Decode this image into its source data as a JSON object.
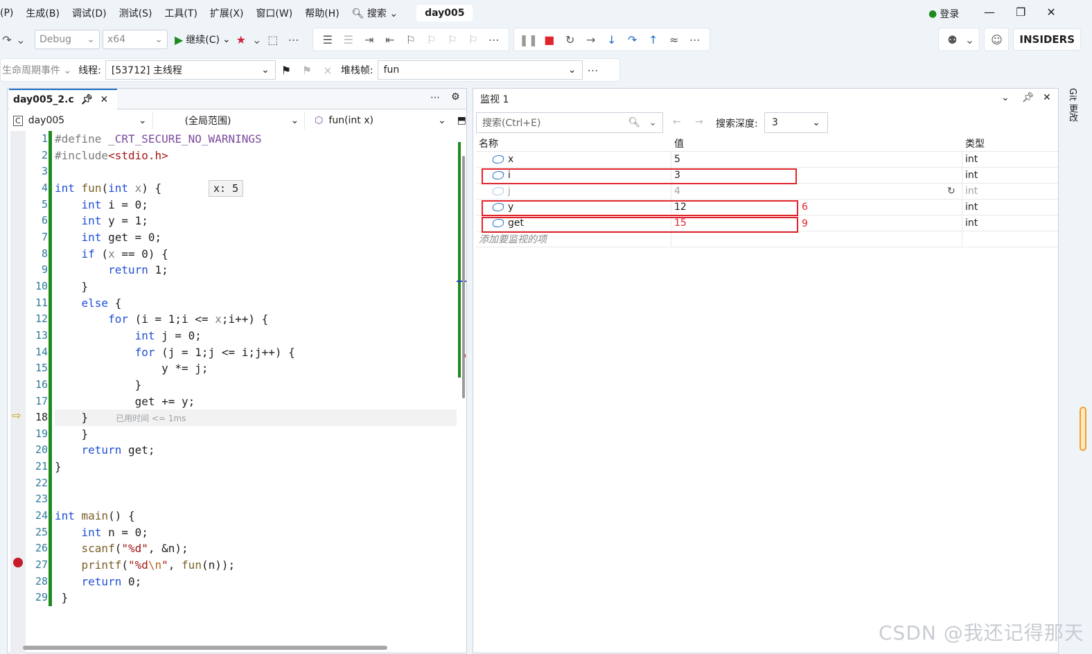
{
  "menubar": {
    "items": [
      "(P)",
      "生成(B)",
      "调试(D)",
      "测试(S)",
      "工具(T)",
      "扩展(X)",
      "窗口(W)",
      "帮助(H)"
    ],
    "search_label": "搜索",
    "solution_name": "day005",
    "login_label": "登录"
  },
  "toolbar": {
    "config": "Debug",
    "platform": "x64",
    "continue_label": "继续(C)",
    "insiders_label": "INSIDERS"
  },
  "threadbar": {
    "lifecycle_label": "生命周期事件",
    "thread_label": "线程:",
    "thread_value": "[53712] 主线程",
    "stackframe_label": "堆栈帧:",
    "stackframe_value": "fun"
  },
  "editor": {
    "tab_title": "day005_2.c",
    "nav_project": "day005",
    "nav_scope": "(全局范围)",
    "nav_function": "fun(int x)",
    "datatip": "x: 5",
    "elapsed_hint": "已用时间 <= 1ms",
    "line_numbers": [
      "1",
      "2",
      "3",
      "4",
      "5",
      "6",
      "7",
      "8",
      "9",
      "10",
      "11",
      "12",
      "13",
      "14",
      "15",
      "16",
      "17",
      "18",
      "19",
      "20",
      "21",
      "22",
      "23",
      "24",
      "25",
      "26",
      "27",
      "28",
      "29"
    ]
  },
  "watch": {
    "title": "监视 1",
    "search_placeholder": "搜索(Ctrl+E)",
    "depth_label": "搜索深度:",
    "depth_value": "3",
    "columns": {
      "name": "名称",
      "value": "值",
      "type": "类型"
    },
    "rows": [
      {
        "name": "x",
        "value": "5",
        "type": "int"
      },
      {
        "name": "i",
        "value": "3",
        "type": "int"
      },
      {
        "name": "j",
        "value": "4",
        "type": "int"
      },
      {
        "name": "y",
        "value": "12",
        "type": "int"
      },
      {
        "name": "get",
        "value": "15",
        "type": "int"
      }
    ],
    "add_placeholder": "添加要监视的项",
    "annotations": {
      "y": "6",
      "get": "9"
    }
  },
  "sidebar": {
    "git_label": "Git 更改"
  },
  "watermark": "CSDN @我还记得那天"
}
